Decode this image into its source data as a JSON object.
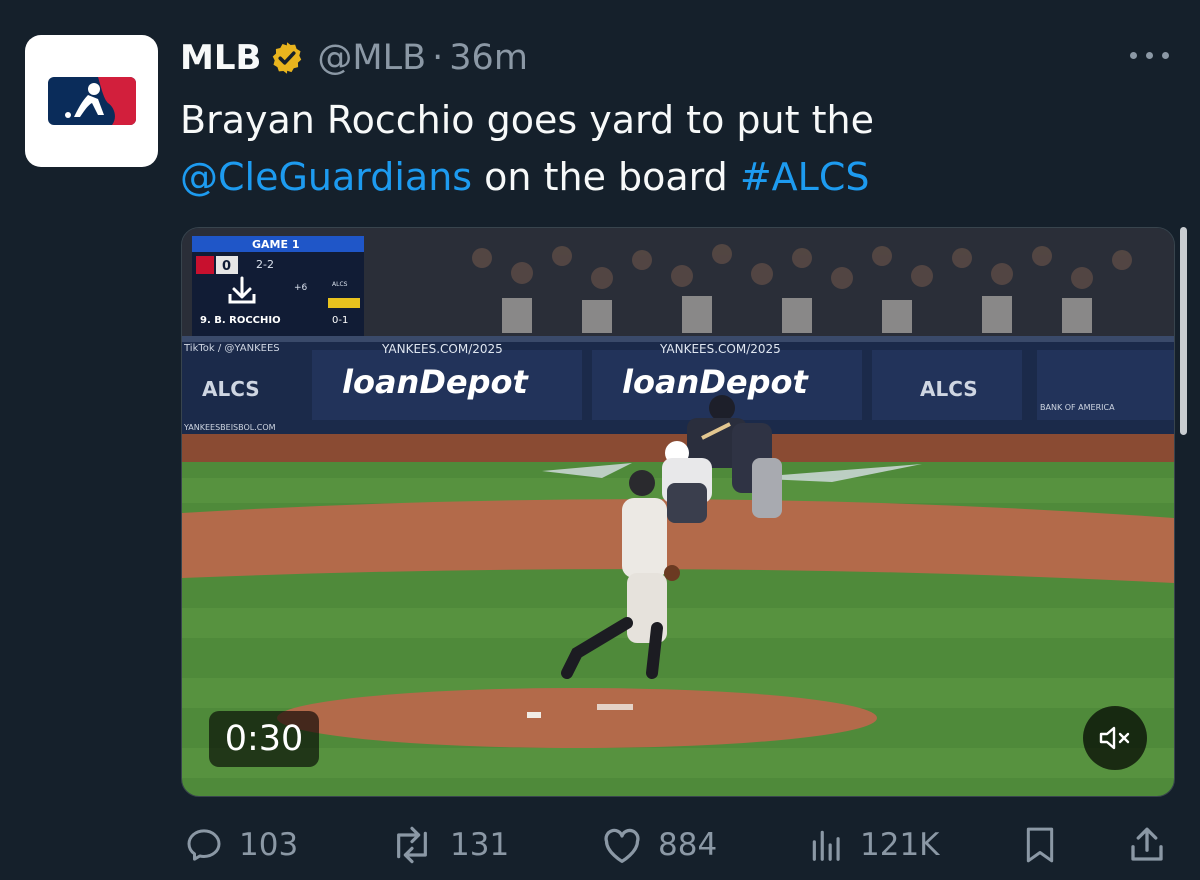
{
  "tweet": {
    "author_name": "MLB",
    "author_handle": "@MLB",
    "separator": "·",
    "time_ago": "36m",
    "text_line1": "Brayan Rocchio goes yard to put the",
    "mention": "@CleGuardians",
    "text_mid": " on the board ",
    "hashtag": "#ALCS"
  },
  "video": {
    "duration": "0:30",
    "scorebug": {
      "game_label": "GAME 1",
      "away_score": "0",
      "count": "2-2",
      "home_runs_line": "+6",
      "series_label": "ALCS",
      "batter": "9. B. ROCCHIO",
      "batter_line": "0-1"
    },
    "overlays": {
      "tiktok": "TikTok / @YANKEES",
      "url1": "YANKEES.COM/2025",
      "url2": "YANKEES.COM/2025",
      "sponsor1": "loanDepot",
      "sponsor2": "loanDepot",
      "alcs": "ALCS",
      "bank": "BANK OF AMERICA",
      "beisbol": "YANKEESBEISBOL.COM"
    }
  },
  "actions": {
    "replies": "103",
    "reposts": "131",
    "likes": "884",
    "views": "121K"
  },
  "icons": {
    "verified": "verified-badge-icon",
    "more": "more-dots-icon",
    "reply": "reply-icon",
    "repost": "repost-icon",
    "like": "heart-icon",
    "views": "views-icon",
    "bookmark": "bookmark-icon",
    "share": "share-icon",
    "mute": "speaker-muted-icon",
    "download": "download-icon"
  },
  "colors": {
    "background": "#15202b",
    "link": "#1d9bf0",
    "muted_text": "#8b98a5",
    "verified_gold": "#e8b41e",
    "mlb_blue": "#0a2c5a",
    "mlb_red": "#d21f3c"
  }
}
